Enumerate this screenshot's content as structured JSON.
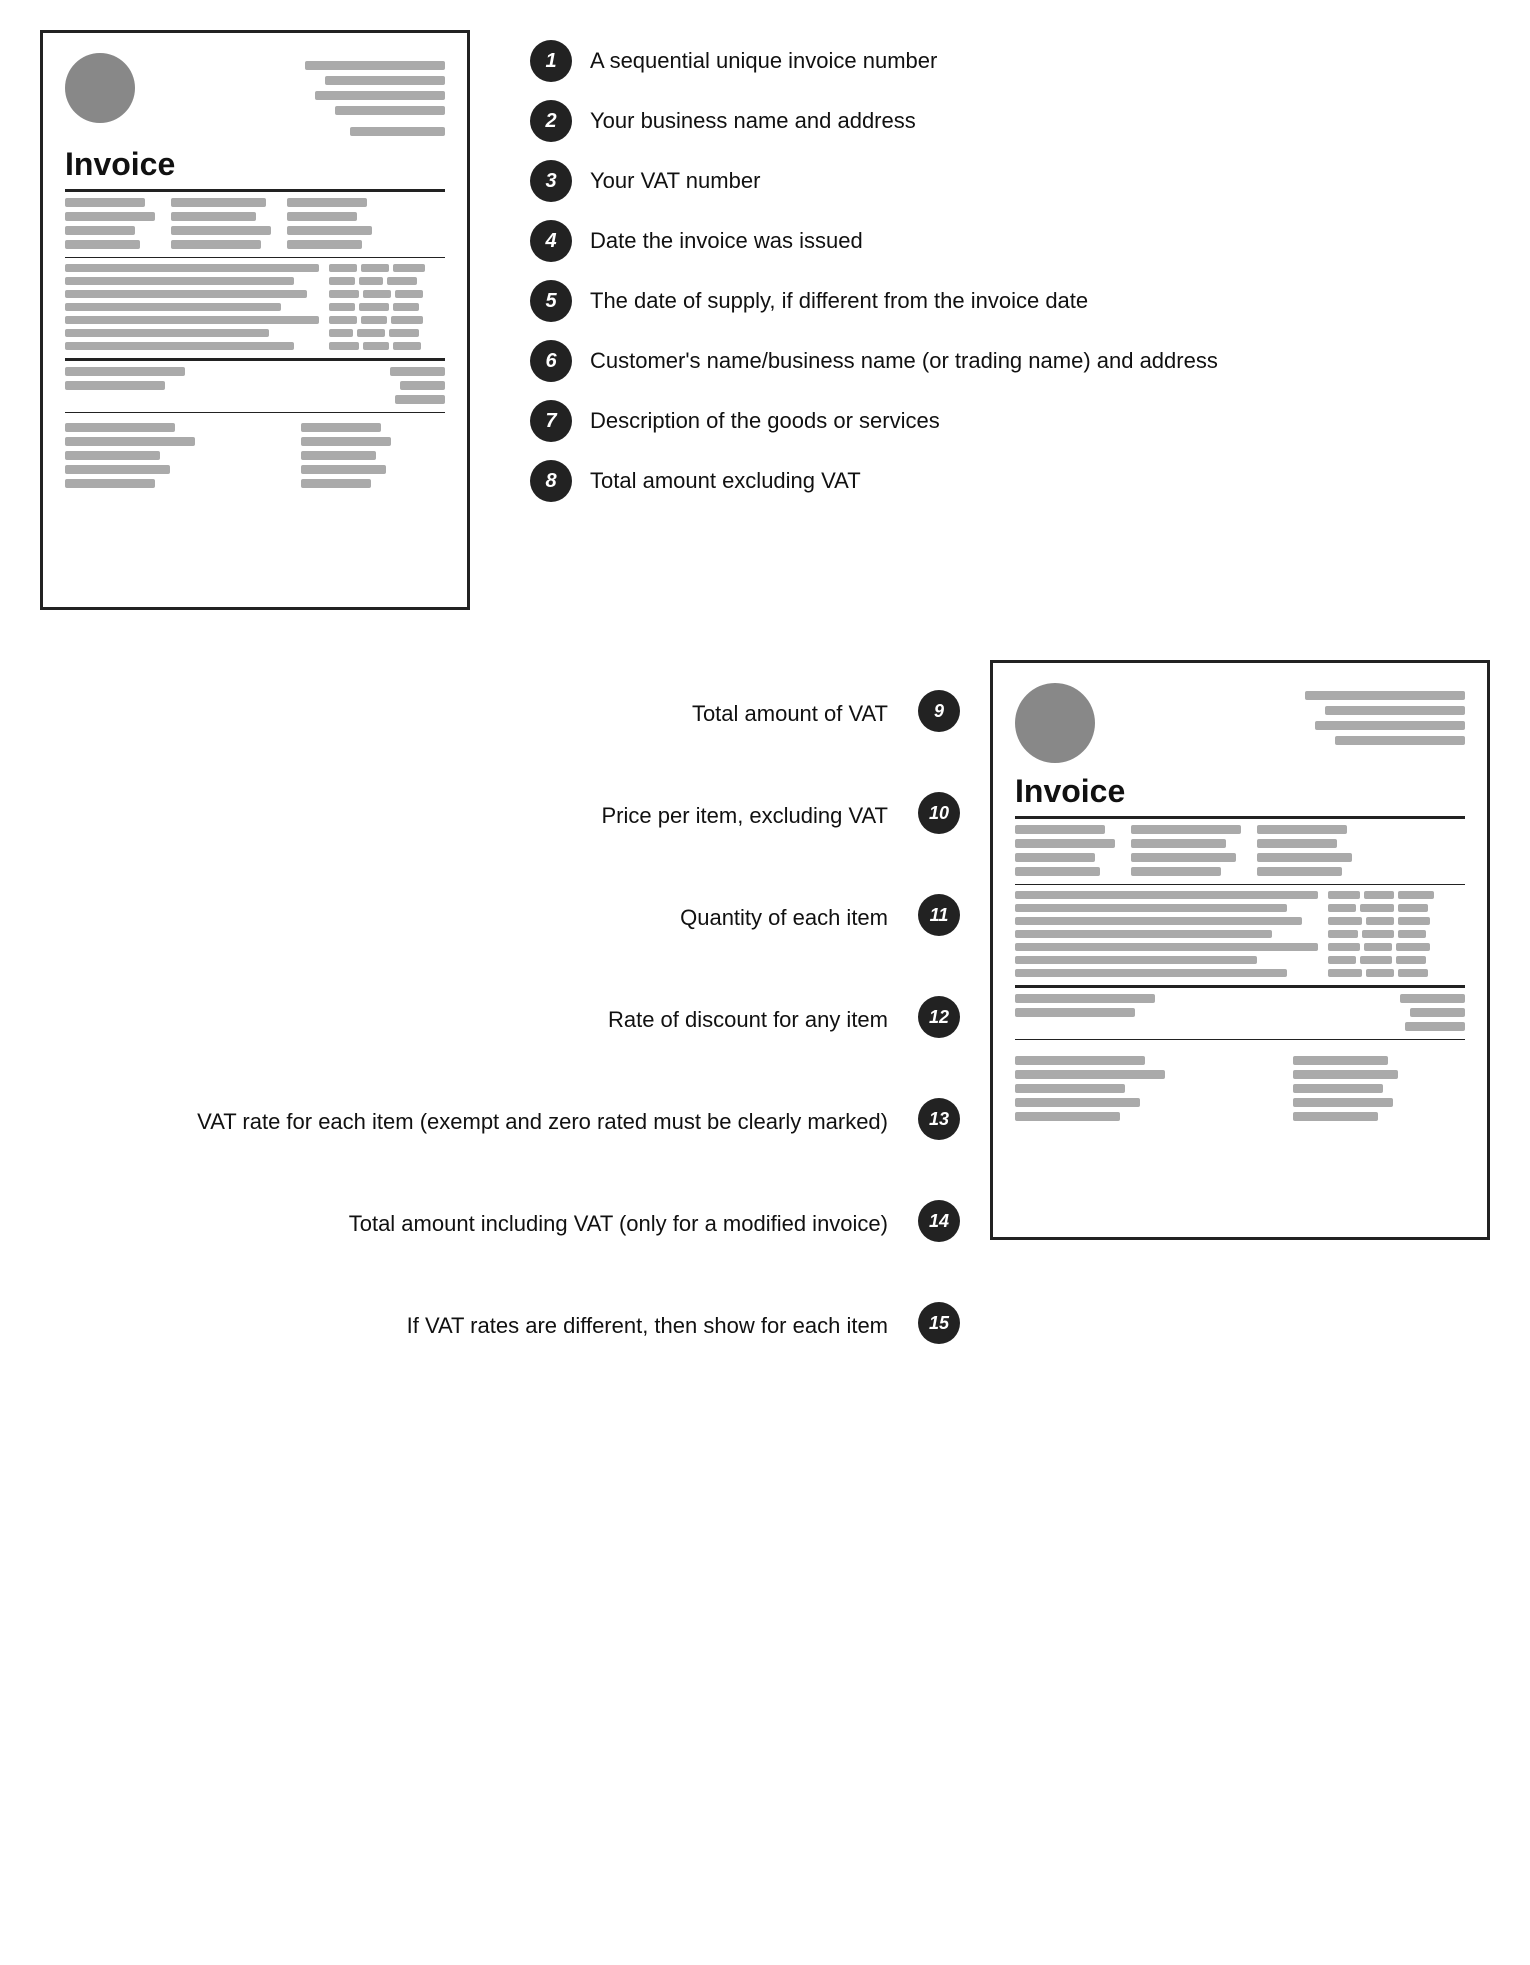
{
  "top": {
    "numbered_items": [
      {
        "number": "1",
        "text": "A sequential unique invoice number"
      },
      {
        "number": "2",
        "text": "Your business name and address"
      },
      {
        "number": "3",
        "text": "Your VAT number"
      },
      {
        "number": "4",
        "text": "Date the invoice was issued"
      },
      {
        "number": "5",
        "text": "The date of supply, if different from the invoice date"
      },
      {
        "number": "6",
        "text": "Customer's name/business name (or trading name) and address"
      },
      {
        "number": "7",
        "text": "Description of the goods or services"
      },
      {
        "number": "8",
        "text": "Total amount excluding VAT"
      }
    ]
  },
  "bottom": {
    "left_items": [
      {
        "number": "9",
        "text": "Total amount of VAT"
      },
      {
        "number": "10",
        "text": "Price per item, excluding VAT"
      },
      {
        "number": "11",
        "text": "Quantity of each item"
      },
      {
        "number": "12",
        "text": "Rate of discount for any item"
      },
      {
        "number": "13",
        "text": "VAT rate for each item (exempt and zero rated must be clearly marked)"
      },
      {
        "number": "14",
        "text": "Total amount including VAT (only for a modified invoice)"
      },
      {
        "number": "15",
        "text": "If VAT rates are different, then show for each item"
      }
    ]
  },
  "invoice_title": "Invoice"
}
